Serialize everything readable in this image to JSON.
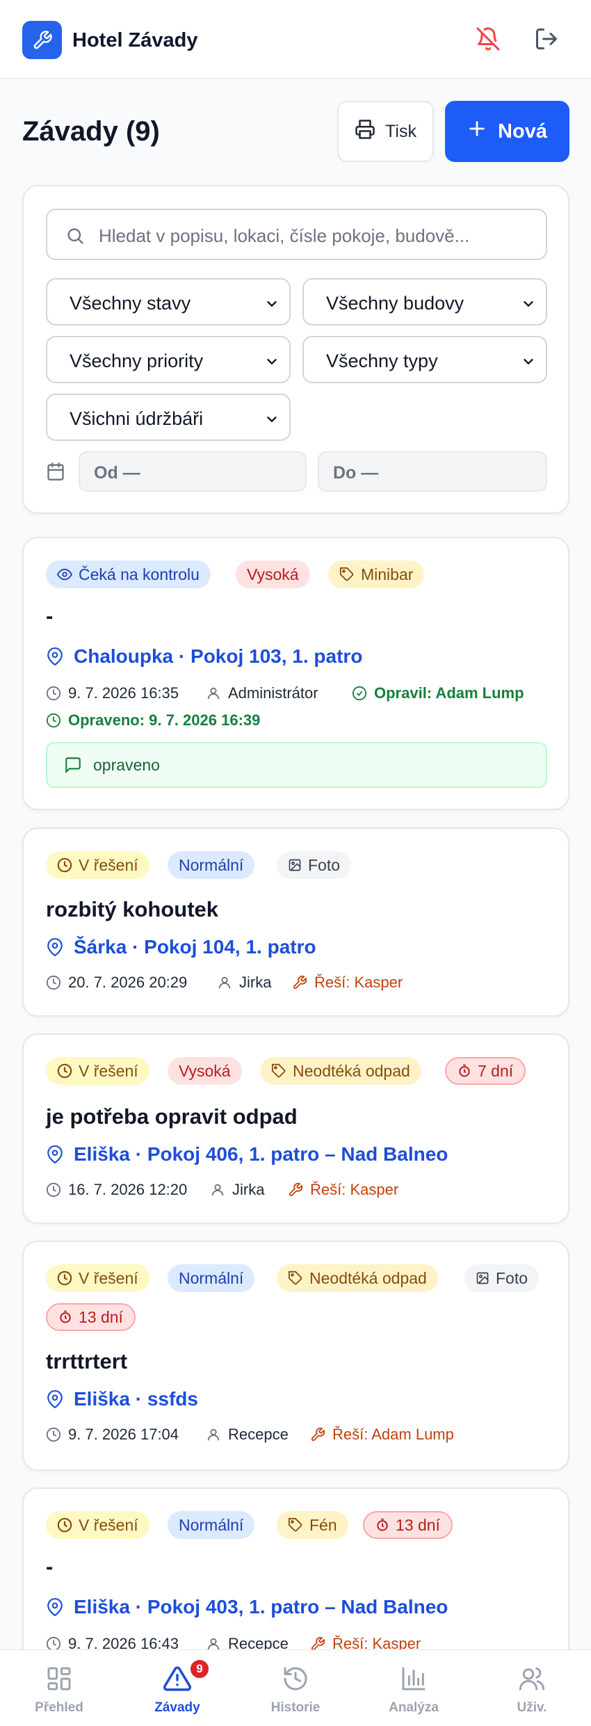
{
  "header": {
    "app_title": "Hotel Závady",
    "logo_icon": "wrench-icon",
    "bell_icon": "bell-off-icon",
    "logout_icon": "logout-icon"
  },
  "page": {
    "title": "Závady (9)",
    "print_label": "Tisk",
    "new_label": "Nová"
  },
  "filters": {
    "search_placeholder": "Hledat v popisu, lokaci, čísle pokoje, budově...",
    "status": "Všechny stavy",
    "building": "Všechny budovy",
    "priority": "Všechny priority",
    "type": "Všechny typy",
    "maintainer": "Všichni údržbáři",
    "date_from": "Od —",
    "date_to": "Do —"
  },
  "issues": [
    {
      "chips": [
        "Čeká na kontrolu",
        "Vysoká",
        "Minibar"
      ],
      "title": "-",
      "location": "Chaloupka · Pokoj 103, 1. patro",
      "date": "9. 7. 2026 16:35",
      "user": "Administrátor",
      "fixed_by": "Opravil: Adam Lump",
      "fixed_at": "Opraveno: 9. 7. 2026 16:39",
      "note": "opraveno"
    },
    {
      "chips": [
        "V řešení",
        "Normální",
        "Foto"
      ],
      "title": "rozbitý kohoutek",
      "location": "Šárka · Pokoj 104, 1. patro",
      "date": "20. 7. 2026 20:29",
      "user": "Jirka",
      "assignee": "Řeší: Kasper"
    },
    {
      "chips": [
        "V řešení",
        "Vysoká",
        "Neodtéká odpad",
        "7 dní"
      ],
      "title": "je potřeba opravit odpad",
      "location": "Eliška · Pokoj 406, 1. patro – Nad Balneo",
      "date": "16. 7. 2026 12:20",
      "user": "Jirka",
      "assignee": "Řeší: Kasper"
    },
    {
      "chips": [
        "V řešení",
        "Normální",
        "Neodtéká odpad",
        "Foto",
        "13 dní"
      ],
      "title": "trrttrtert",
      "location": "Eliška · ssfds",
      "date": "9. 7. 2026 17:04",
      "user": "Recepce",
      "assignee": "Řeší: Adam Lump"
    },
    {
      "chips": [
        "V řešení",
        "Normální",
        "Fén",
        "13 dní"
      ],
      "title": "-",
      "location": "Eliška · Pokoj 403, 1. patro – Nad Balneo",
      "date": "9. 7. 2026 16:43",
      "user": "Recepce",
      "assignee": "Řeší: Kasper"
    }
  ],
  "nav": {
    "items": [
      "Přehled",
      "Závady",
      "Historie",
      "Analýza",
      "Uživ."
    ],
    "badge": "9"
  },
  "colors": {
    "accent": "#1d5cf6",
    "link": "#1d4ed8",
    "danger": "#dc2626",
    "success": "#15803d",
    "warning": "#c2410c"
  }
}
